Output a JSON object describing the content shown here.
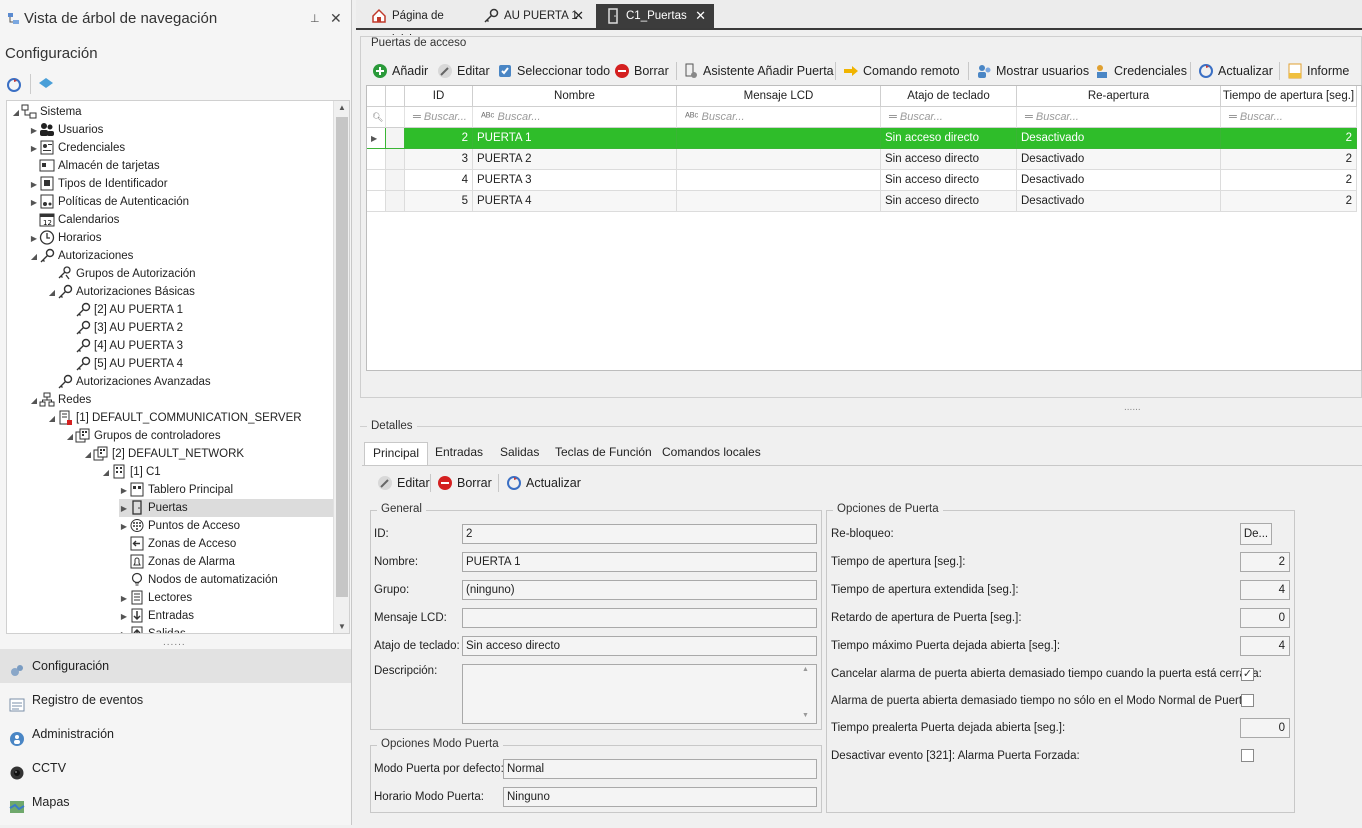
{
  "left_panel": {
    "title": "Vista de árbol de navegación",
    "pin": "⊥",
    "close": "✕",
    "section": "Configuración",
    "tree": [
      {
        "label": "Sistema",
        "arrow": "◢",
        "icon": "system"
      },
      {
        "label": "Usuarios",
        "arrow": "▶",
        "icon": "users"
      },
      {
        "label": "Credenciales",
        "arrow": "▶",
        "icon": "credentials"
      },
      {
        "label": "Almacén de tarjetas",
        "arrow": "",
        "icon": "card-store"
      },
      {
        "label": "Tipos de Identificador",
        "arrow": "▶",
        "icon": "identifier"
      },
      {
        "label": "Políticas de Autenticación",
        "arrow": "▶",
        "icon": "auth-policy"
      },
      {
        "label": "Calendarios",
        "arrow": "",
        "icon": "calendar"
      },
      {
        "label": "Horarios",
        "arrow": "▶",
        "icon": "clock"
      },
      {
        "label": "Autorizaciones",
        "arrow": "◢",
        "icon": "key"
      },
      {
        "label": "Grupos de Autorización",
        "arrow": "",
        "icon": "keys"
      },
      {
        "label": "Autorizaciones Básicas",
        "arrow": "◢",
        "icon": "key"
      },
      {
        "label": "[2] AU PUERTA 1",
        "arrow": "",
        "icon": "key"
      },
      {
        "label": "[3] AU PUERTA 2",
        "arrow": "",
        "icon": "key"
      },
      {
        "label": "[4] AU PUERTA 3",
        "arrow": "",
        "icon": "key"
      },
      {
        "label": "[5] AU PUERTA 4",
        "arrow": "",
        "icon": "key"
      },
      {
        "label": "Autorizaciones Avanzadas",
        "arrow": "",
        "icon": "key"
      },
      {
        "label": "Redes",
        "arrow": "◢",
        "icon": "network"
      },
      {
        "label": "[1] DEFAULT_COMMUNICATION_SERVER",
        "arrow": "◢",
        "icon": "server"
      },
      {
        "label": "Grupos de controladores",
        "arrow": "◢",
        "icon": "controllers"
      },
      {
        "label": "[2] DEFAULT_NETWORK",
        "arrow": "◢",
        "icon": "controllers"
      },
      {
        "label": "[1] C1",
        "arrow": "◢",
        "icon": "controller"
      },
      {
        "label": "Tablero Principal",
        "arrow": "▶",
        "icon": "board"
      },
      {
        "label": "Puertas",
        "arrow": "▶",
        "icon": "door"
      },
      {
        "label": "Puntos de Acceso",
        "arrow": "▶",
        "icon": "access-point"
      },
      {
        "label": "Zonas de Acceso",
        "arrow": "",
        "icon": "access-zone"
      },
      {
        "label": "Zonas de Alarma",
        "arrow": "",
        "icon": "alarm-zone"
      },
      {
        "label": "Nodos de automatización",
        "arrow": "",
        "icon": "bulb"
      },
      {
        "label": "Lectores",
        "arrow": "▶",
        "icon": "reader"
      },
      {
        "label": "Entradas",
        "arrow": "▶",
        "icon": "input"
      },
      {
        "label": "Salidas",
        "arrow": "▶",
        "icon": "output"
      }
    ],
    "splitter": "......",
    "nav": [
      {
        "label": "Configuración",
        "icon": "gears"
      },
      {
        "label": "Registro de eventos",
        "icon": "log"
      },
      {
        "label": "Administración",
        "icon": "admin"
      },
      {
        "label": "CCTV",
        "icon": "camera"
      },
      {
        "label": "Mapas",
        "icon": "map"
      }
    ]
  },
  "tabs": [
    {
      "label": "Página de inicio",
      "icon": "home",
      "close": ""
    },
    {
      "label": "AU PUERTA 1",
      "icon": "key",
      "close": "✕"
    },
    {
      "label": "C1_Puertas",
      "icon": "door",
      "close": "✕"
    }
  ],
  "access": {
    "group_title": "Puertas de acceso",
    "toolbar": [
      "Añadir",
      "Editar",
      "Seleccionar todo",
      "Borrar",
      "Asistente Añadir Puerta",
      "Comando remoto",
      "Mostrar usuarios",
      "Credenciales",
      "Actualizar",
      "Informe"
    ],
    "columns": [
      "ID",
      "Nombre",
      "Mensaje LCD",
      "Atajo de teclado",
      "Re-apertura",
      "Tiempo de apertura [seg.]"
    ],
    "search_placeholder": "Buscar...",
    "rows": [
      {
        "id": "2",
        "name": "PUERTA 1",
        "lcd": "",
        "shortcut": "Sin acceso directo",
        "reopen": "Desactivado",
        "time": "2"
      },
      {
        "id": "3",
        "name": "PUERTA 2",
        "lcd": "",
        "shortcut": "Sin acceso directo",
        "reopen": "Desactivado",
        "time": "2"
      },
      {
        "id": "4",
        "name": "PUERTA 3",
        "lcd": "",
        "shortcut": "Sin acceso directo",
        "reopen": "Desactivado",
        "time": "2"
      },
      {
        "id": "5",
        "name": "PUERTA 4",
        "lcd": "",
        "shortcut": "Sin acceso directo",
        "reopen": "Desactivado",
        "time": "2"
      }
    ],
    "selected_row": 0,
    "selected_color": "#2fbd2a"
  },
  "details": {
    "group_title": "Detalles",
    "splitter": "......",
    "tabs": [
      "Principal",
      "Entradas",
      "Salidas",
      "Teclas de Función",
      "Comandos locales"
    ],
    "active_tab": 0,
    "toolbar": [
      "Editar",
      "Borrar",
      "Actualizar"
    ],
    "general": {
      "title": "General",
      "id_label": "ID:",
      "id": "2",
      "name_label": "Nombre:",
      "name": "PUERTA 1",
      "group_label": "Grupo:",
      "group": "(ninguno)",
      "lcd_label": "Mensaje LCD:",
      "lcd": "",
      "shortcut_label": "Atajo de teclado:",
      "shortcut": "Sin acceso directo",
      "desc_label": "Descripción:",
      "desc": ""
    },
    "mode": {
      "title": "Opciones Modo Puerta",
      "default_label": "Modo Puerta por defecto:",
      "default": "Normal",
      "schedule_label": "Horario Modo Puerta:",
      "schedule": "Ninguno"
    },
    "door_options": {
      "title": "Opciones de Puerta",
      "relock_label": "Re-bloqueo:",
      "relock": "De...",
      "open_time_label": "Tiempo de apertura [seg.]:",
      "open_time": "2",
      "ext_time_label": "Tiempo de apertura extendida [seg.]:",
      "ext_time": "4",
      "delay_label": "Retardo de apertura de Puerta [seg.]:",
      "delay": "0",
      "max_open_label": "Tiempo máximo Puerta dejada abierta [seg.]:",
      "max_open": "4",
      "cancel_alarm_label": "Cancelar alarma de puerta abierta demasiado tiempo cuando la puerta está cerrada:",
      "cancel_alarm": true,
      "alarm_all_label": "Alarma de puerta abierta demasiado tiempo no sólo en el Modo Normal de Puerta:",
      "alarm_all": false,
      "prealert_label": "Tiempo prealerta Puerta dejada abierta [seg.]:",
      "prealert": "0",
      "disable_event_label": "Desactivar evento [321]: Alarma Puerta Forzada:",
      "disable_event": false
    }
  }
}
